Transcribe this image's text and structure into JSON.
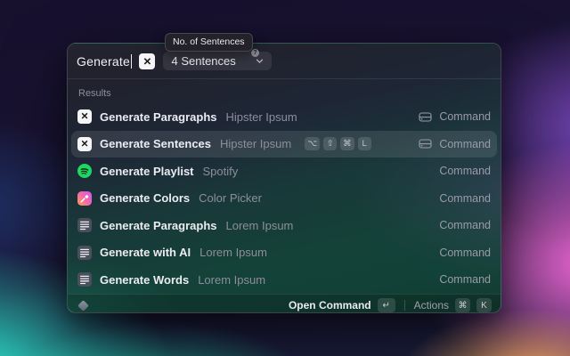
{
  "tooltip": {
    "text": "No. of Sentences"
  },
  "search": {
    "value": "Generate",
    "extension_icon": "hipster-ipsum-icon",
    "dropdown": {
      "label": "4 Sentences",
      "badge": "?"
    }
  },
  "results": {
    "section_label": "Results",
    "items": [
      {
        "icon": "hipster-ipsum-icon",
        "title": "Generate Paragraphs",
        "subtitle": "Hipster Ipsum",
        "accessory_icon": "drive-icon",
        "type": "Command"
      },
      {
        "icon": "hipster-ipsum-icon",
        "title": "Generate Sentences",
        "subtitle": "Hipster Ipsum",
        "accessory_icon": "drive-icon",
        "type": "Command",
        "selected": true,
        "shortcuts": [
          "⌥",
          "⇧",
          "⌘",
          "L"
        ]
      },
      {
        "icon": "spotify-icon",
        "title": "Generate Playlist",
        "subtitle": "Spotify",
        "type": "Command"
      },
      {
        "icon": "color-picker-icon",
        "title": "Generate Colors",
        "subtitle": "Color Picker",
        "type": "Command"
      },
      {
        "icon": "lorem-ipsum-icon",
        "title": "Generate Paragraphs",
        "subtitle": "Lorem Ipsum",
        "type": "Command"
      },
      {
        "icon": "lorem-ipsum-icon",
        "title": "Generate with AI",
        "subtitle": "Lorem Ipsum",
        "type": "Command"
      },
      {
        "icon": "lorem-ipsum-icon",
        "title": "Generate Words",
        "subtitle": "Lorem Ipsum",
        "type": "Command"
      }
    ]
  },
  "footer": {
    "primary_label": "Open Command",
    "primary_key": "↵",
    "actions_label": "Actions",
    "actions_keys": [
      "⌘",
      "K"
    ]
  },
  "icon_glyphs": {
    "hipster_x": "✕"
  },
  "colors": {
    "spotify_green": "#1ED760",
    "selection_highlight": "rgba(255,255,255,0.10)",
    "desktop_cyan": "#2ef5d8",
    "desktop_pink": "#ec66d4",
    "desktop_purple": "#7c48be",
    "desktop_orange": "#f7a65f",
    "desktop_navy": "#17112e"
  }
}
